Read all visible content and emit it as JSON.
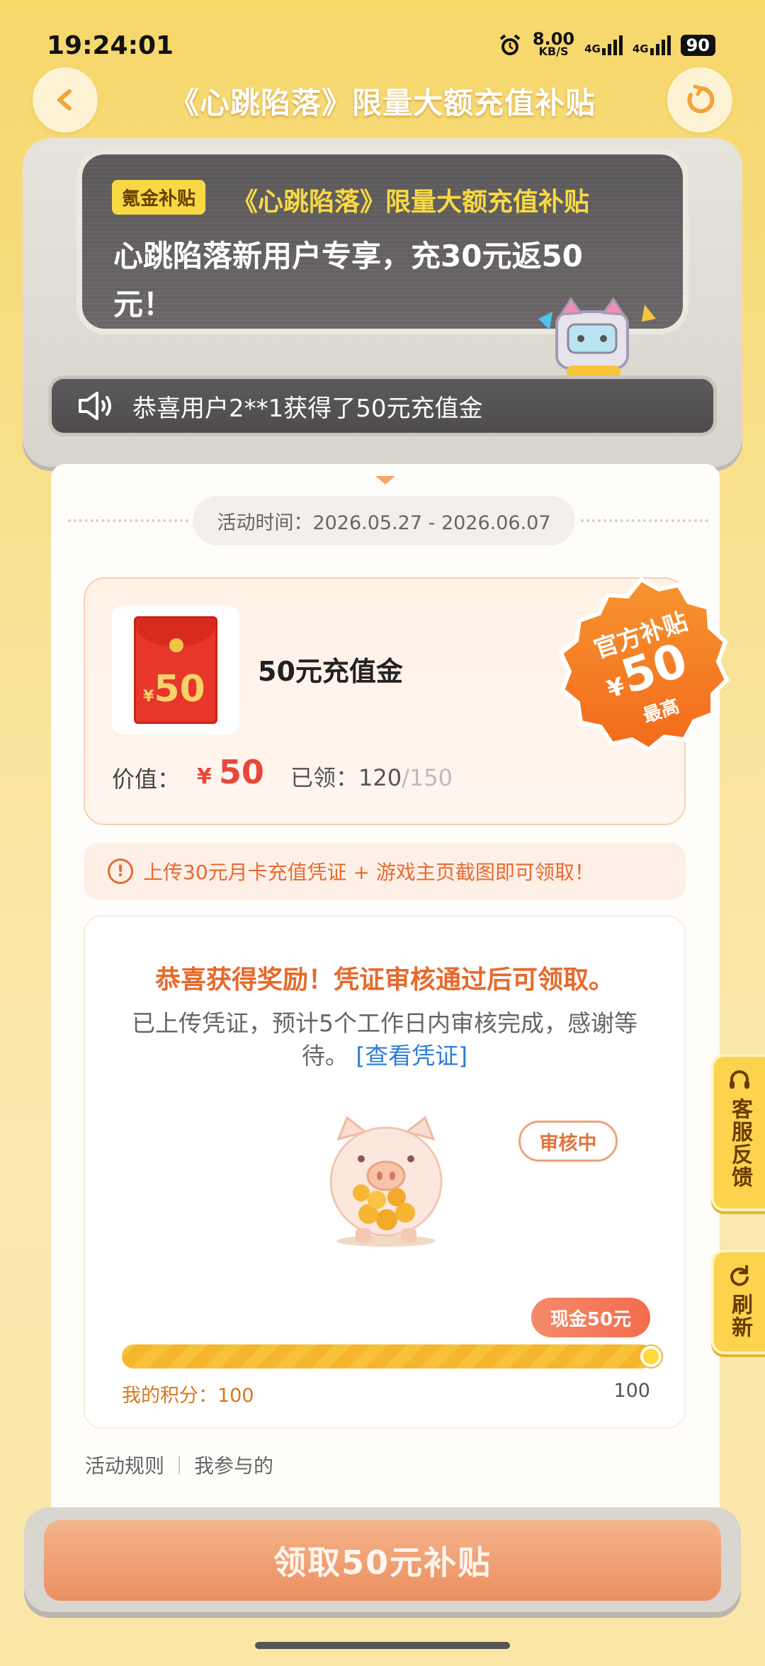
{
  "status_bar": {
    "time": "19:24:01",
    "net_speed": "8.00",
    "net_unit": "KB/S",
    "sim1": "4G",
    "sim2": "4G",
    "battery": "90"
  },
  "header": {
    "title": "《心跳陷落》限量大额充值补贴"
  },
  "banner": {
    "tag": "氪金补贴",
    "title": "《心跳陷落》限量大额充值补贴",
    "description": "心跳陷落新用户专享，充30元返50元！"
  },
  "ticker": {
    "text": "恭喜用户2**1获得了50元充值金"
  },
  "activity": {
    "date_label": "活动时间：2026.05.27 - 2026.06.07"
  },
  "reward": {
    "thumb_currency": "¥",
    "thumb_amount": "50",
    "name": "50元充值金",
    "value_label": "价值：",
    "currency": "¥",
    "value": "50",
    "claimed_label": "已领：",
    "claimed": "120",
    "total": "/150"
  },
  "official_badge": {
    "line1": "官方补贴",
    "currency": "¥",
    "amount": "50",
    "line3": "最高"
  },
  "notice": {
    "icon": "!",
    "text": "上传30元月卡充值凭证 + 游戏主页截图即可领取！"
  },
  "status": {
    "congrats": "恭喜获得奖励！凭证审核通过后可领取。",
    "description": "已上传凭证，预计5个工作日内审核完成，感谢等待。",
    "view_link": "[查看凭证]",
    "review_badge": "审核中",
    "cash_badge": "现金50元",
    "score_label": "我的积分：100",
    "score_max": "100",
    "progress": 1.0
  },
  "footer": {
    "rules": "活动规则",
    "mine": "我参与的"
  },
  "side": {
    "feedback": "客服反馈",
    "refresh": "刷新"
  },
  "claim_button": "领取50元补贴",
  "colors": {
    "accent": "#f7c23a",
    "orange": "#e66a2c",
    "red": "#e8483a",
    "link": "#2d7fd6"
  }
}
